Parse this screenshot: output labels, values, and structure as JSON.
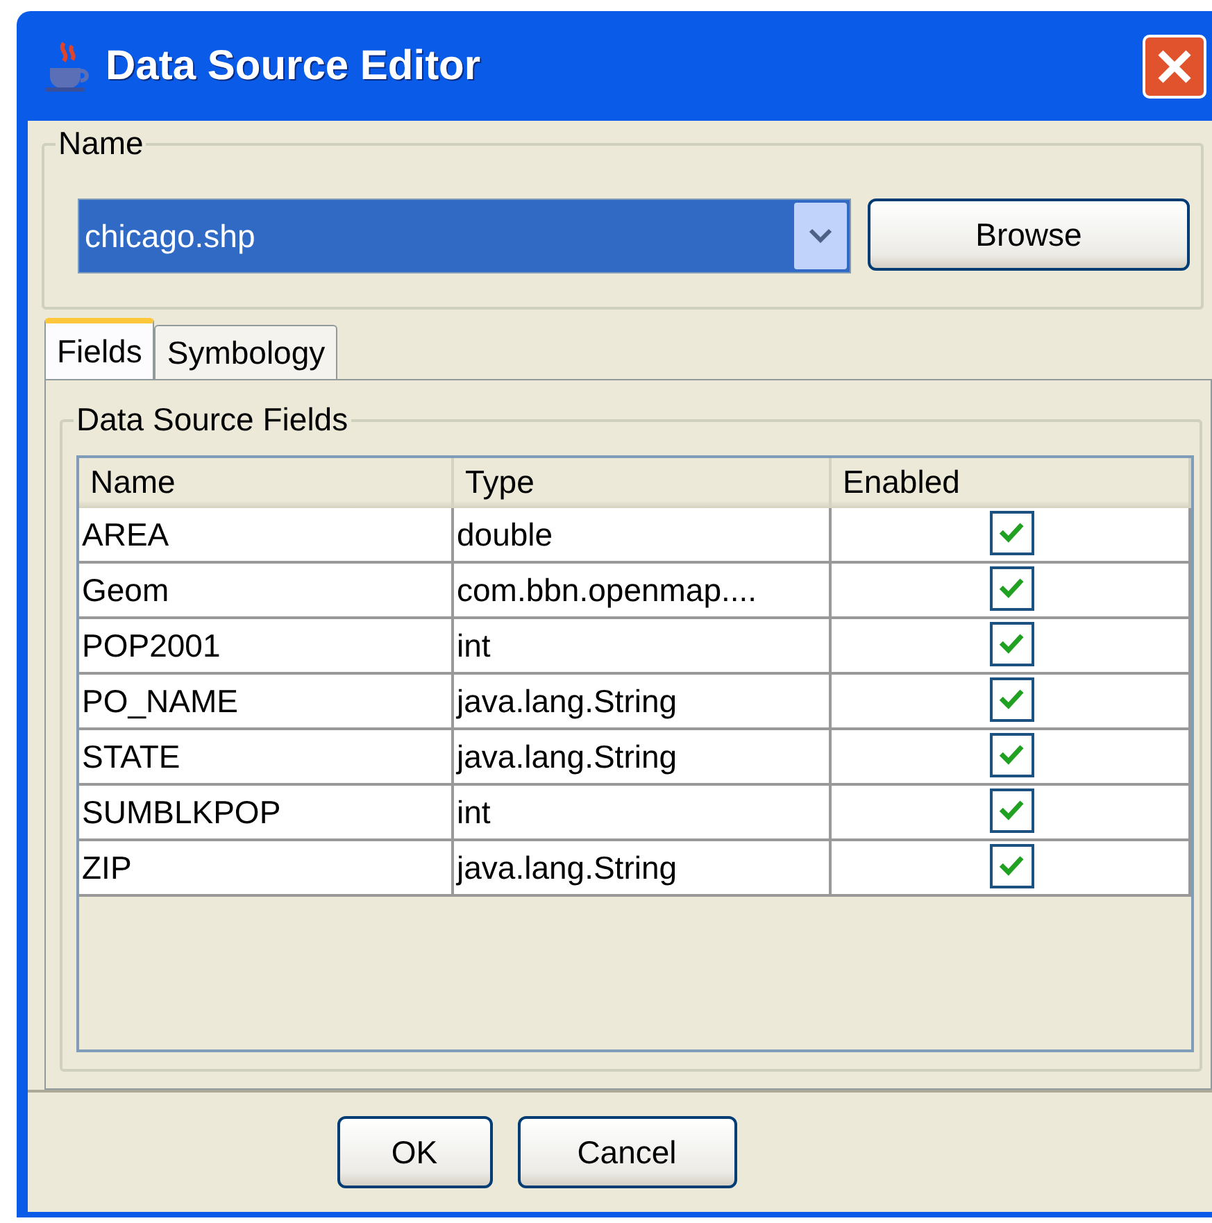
{
  "window": {
    "title": "Data Source Editor"
  },
  "name_group": {
    "label": "Name",
    "value": "chicago.shp",
    "browse_button": "Browse"
  },
  "tabs": [
    {
      "label": "Fields",
      "selected": true
    },
    {
      "label": "Symbology",
      "selected": false
    }
  ],
  "fields_group": {
    "label": "Data Source Fields"
  },
  "table": {
    "columns": [
      "Name",
      "Type",
      "Enabled"
    ],
    "rows": [
      {
        "name": "AREA",
        "type": "double",
        "enabled": true
      },
      {
        "name": "Geom",
        "type": "com.bbn.openmap....",
        "enabled": true
      },
      {
        "name": "POP2001",
        "type": "int",
        "enabled": true
      },
      {
        "name": "PO_NAME",
        "type": "java.lang.String",
        "enabled": true
      },
      {
        "name": "STATE",
        "type": "java.lang.String",
        "enabled": true
      },
      {
        "name": "SUMBLKPOP",
        "type": "int",
        "enabled": true
      },
      {
        "name": "ZIP",
        "type": "java.lang.String",
        "enabled": true
      }
    ]
  },
  "buttons": [
    "OK",
    "Cancel"
  ]
}
